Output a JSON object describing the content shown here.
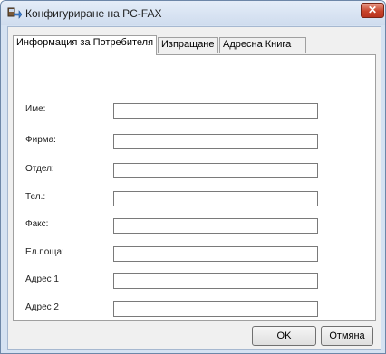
{
  "window": {
    "title": "Конфигуриране на PC-FAX",
    "close_glyph": "✕"
  },
  "tabs": [
    {
      "label": "Информация за Потребителя",
      "active": true
    },
    {
      "label": "Изпращане",
      "active": false
    },
    {
      "label": "Адресна Книга",
      "active": false
    }
  ],
  "fields": [
    {
      "label": "Име:",
      "value": ""
    },
    {
      "label": "Фирма:",
      "value": ""
    },
    {
      "label": "Отдел:",
      "value": ""
    },
    {
      "label": "Тел.:",
      "value": ""
    },
    {
      "label": "Факс:",
      "value": ""
    },
    {
      "label": "Ел.поща:",
      "value": ""
    },
    {
      "label": "Адрес 1",
      "value": ""
    },
    {
      "label": "Адрес 2",
      "value": ""
    }
  ],
  "buttons": {
    "ok_label": "OK",
    "cancel_label": "Отмяна"
  },
  "icons": {
    "app": "pc-fax-config-icon",
    "close": "close-icon"
  },
  "colors": {
    "close_button": "#c8442b",
    "title_bar": "#cfdcee"
  }
}
